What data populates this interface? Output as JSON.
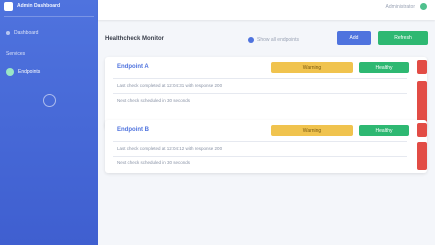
{
  "sidebar": {
    "brand": "Admin Dashboard",
    "items": [
      {
        "label": "Dashboard"
      },
      {
        "label": "Services"
      },
      {
        "label": "Endpoints"
      }
    ]
  },
  "topbar": {
    "user_name": "Administrator"
  },
  "page": {
    "title": "Healthcheck Monitor",
    "radio_label": "Show all endpoints",
    "add_button": "Add",
    "refresh_button": "Refresh"
  },
  "cards": [
    {
      "title": "Endpoint A",
      "status_button": "Warning",
      "ok_button": "Healthy",
      "lines": [
        "Last check completed at 12:04:31 with response 200",
        "Next check scheduled in 30 seconds"
      ]
    },
    {
      "title": "Endpoint B",
      "status_button": "Warning",
      "ok_button": "Healthy",
      "lines": [
        "Last check completed at 12:04:12 with response 200",
        "Next check scheduled in 30 seconds"
      ]
    }
  ],
  "colors": {
    "accent": "#4f73de",
    "success": "#2eb872",
    "warning": "#f0c34e",
    "danger": "#e24c45"
  }
}
